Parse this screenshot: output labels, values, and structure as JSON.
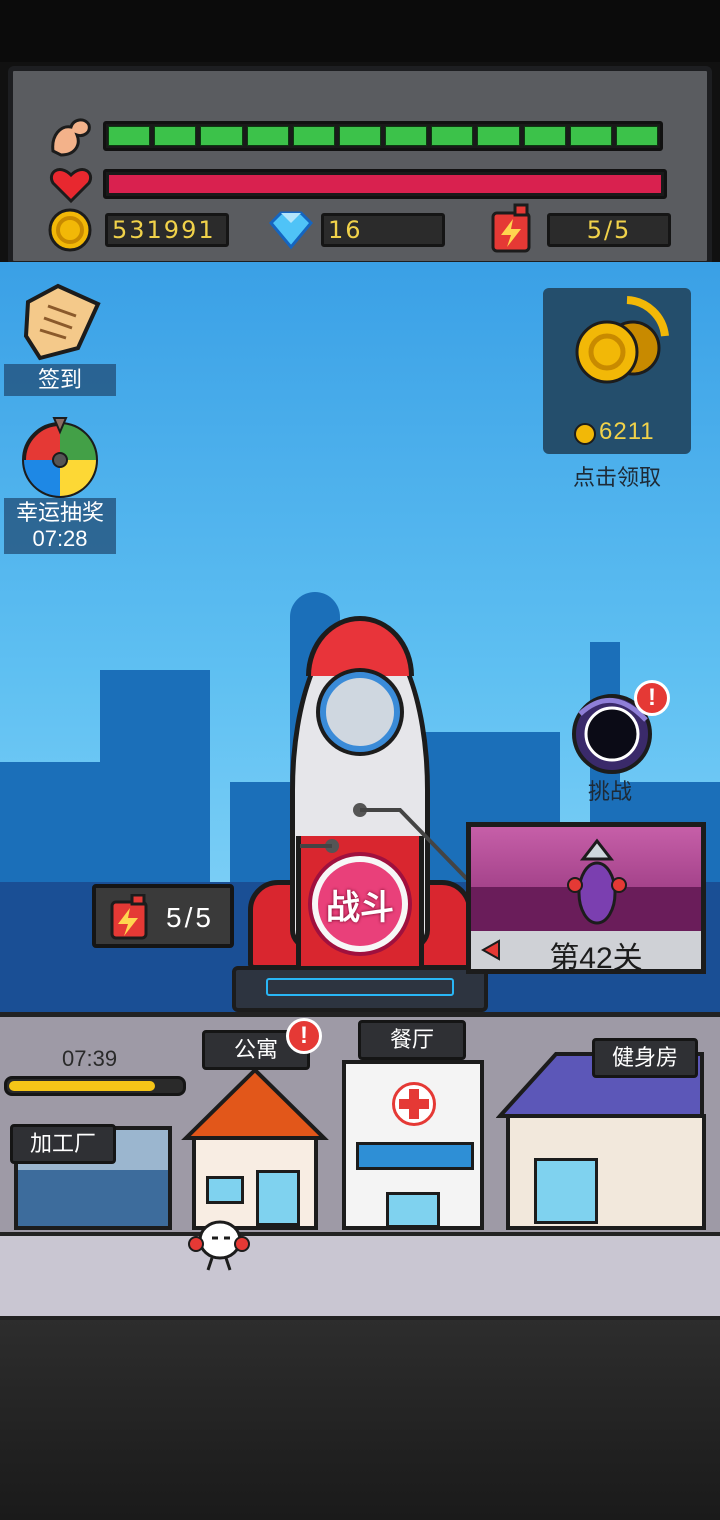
{
  "stats": {
    "strength_segments": 12,
    "hp_fill": 1.0,
    "coins": "531991",
    "gems": "16",
    "energy": "5/5"
  },
  "sidebar": {
    "checkin_label": "签到",
    "lucky_draw_label": "幸运抽奖",
    "lucky_draw_timer": "07:28"
  },
  "reward": {
    "amount": "6211",
    "caption": "点击领取"
  },
  "challenge": {
    "label": "挑战",
    "alert": "!"
  },
  "fight": {
    "label": "战斗",
    "energy": "5/5"
  },
  "stage": {
    "label": "第42关"
  },
  "street": {
    "timer": "07:39",
    "progress": 0.85,
    "buildings": {
      "factory": "加工厂",
      "apartment": "公寓",
      "restaurant": "餐厅",
      "gym": "健身房"
    },
    "apartment_alert": "!"
  },
  "colors": {
    "strength": "#3cc24a",
    "hp": "#d9214f",
    "value_text": "#f1d24a"
  }
}
